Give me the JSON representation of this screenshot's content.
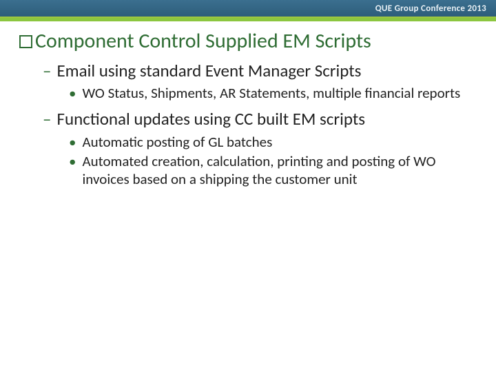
{
  "header": {
    "text": "QUE Group Conference 2013"
  },
  "title": "Component Control Supplied EM Scripts",
  "items": [
    {
      "text": "Email using standard Event Manager Scripts",
      "sub": [
        "WO Status, Shipments, AR Statements, multiple financial reports"
      ]
    },
    {
      "text": "Functional updates using CC built EM scripts",
      "sub": [
        "Automatic posting of GL batches",
        "Automated creation, calculation, printing and posting of WO invoices based on a shipping the customer unit"
      ]
    }
  ]
}
